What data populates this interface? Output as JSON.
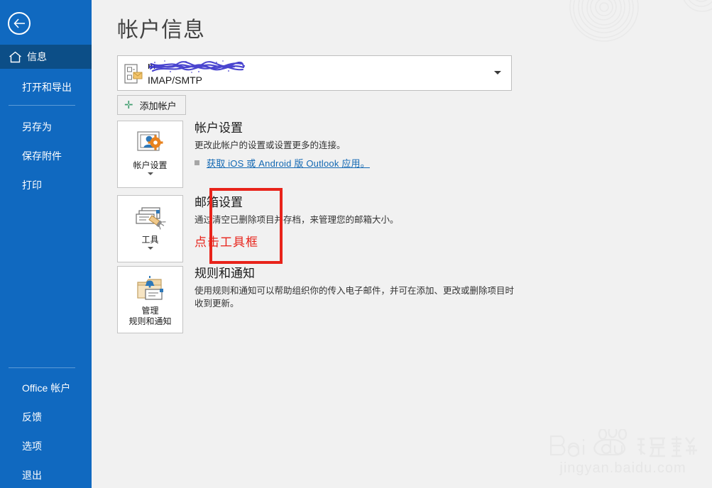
{
  "sidebar": {
    "back_button": "back-arrow-icon",
    "items": [
      {
        "label": "信息",
        "icon": "home-icon",
        "active": true
      },
      {
        "label": "打开和导出",
        "active": false
      },
      {
        "label": "另存为",
        "active": false
      },
      {
        "label": "保存附件",
        "active": false
      },
      {
        "label": "打印",
        "active": false
      },
      {
        "label": "Office 帐户",
        "active": false
      },
      {
        "label": "反馈",
        "active": false
      },
      {
        "label": "选项",
        "active": false
      },
      {
        "label": "退出",
        "active": false
      }
    ]
  },
  "main": {
    "page_title": "帐户信息",
    "account": {
      "name": "",
      "name_suffix": "m",
      "protocol": "IMAP/SMTP",
      "icon": "mail-account-icon",
      "caret": "chevron-down-icon",
      "redacted": true
    },
    "add_account_button": "添加帐户",
    "sections": [
      {
        "tile_label": "帐户设置",
        "tile_icon": "account-settings-icon",
        "has_caret": true,
        "title": "帐户设置",
        "desc": "更改此帐户的设置或设置更多的连接。",
        "link": "获取 iOS 或 Android 版 Outlook 应用。",
        "annotation": ""
      },
      {
        "tile_label": "工具",
        "tile_icon": "cleanup-tools-icon",
        "has_caret": true,
        "title": "邮箱设置",
        "desc": "通过清空已删除项目并存档，来管理您的邮箱大小。",
        "link": "",
        "annotation": "点击工具框"
      },
      {
        "tile_label": "管理\n规则和通知",
        "tile_icon": "rules-alerts-icon",
        "has_caret": false,
        "title": "规则和通知",
        "desc": "使用规则和通知可以帮助组织你的传入电子邮件，并可在添加、更改或删除项目时收到更新。",
        "link": "",
        "annotation": ""
      }
    ]
  },
  "watermark": {
    "brand_bai": "Bai",
    "brand_du": "du",
    "brand_cn": "经验",
    "url": "jingyan.baidu.com"
  },
  "colors": {
    "sidebar_blue": "#1069c0",
    "sidebar_active": "#0c4e87",
    "content_bg": "#f1f1f1",
    "link_blue": "#1268b3",
    "annotation_red": "#e8231a",
    "accent_green": "#3f9d6e",
    "redact_blue": "#3b36cc"
  }
}
